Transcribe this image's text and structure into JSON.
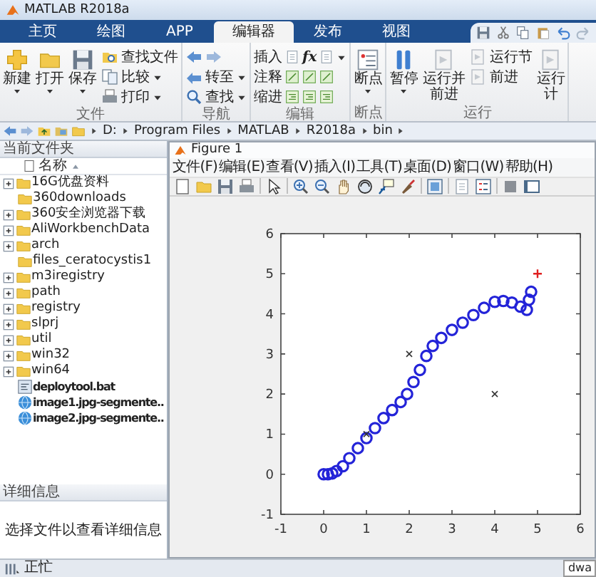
{
  "window": {
    "title": "MATLAB R2018a"
  },
  "tabs": [
    {
      "label": "主页",
      "selected": false
    },
    {
      "label": "绘图",
      "selected": false
    },
    {
      "label": "APP",
      "selected": false
    },
    {
      "label": "编辑器",
      "selected": true
    },
    {
      "label": "发布",
      "selected": false
    },
    {
      "label": "视图",
      "selected": false
    }
  ],
  "ribbon": [
    {
      "label": "文件",
      "buttons": [
        {
          "kind": "large",
          "lines": [
            "新建"
          ],
          "dropdown": true
        },
        {
          "kind": "large",
          "lines": [
            "打开"
          ],
          "dropdown": true
        },
        {
          "kind": "large",
          "lines": [
            "保存"
          ],
          "dropdown": true
        },
        {
          "kind": "stack",
          "items": [
            {
              "label": "查找文件",
              "dropdown": false
            },
            {
              "label": "比较",
              "dropdown": true
            },
            {
              "label": "打印",
              "dropdown": true
            }
          ]
        }
      ]
    },
    {
      "label": "导航",
      "buttons": [
        {
          "kind": "stack",
          "items": [
            {
              "kind": "icons"
            },
            {
              "label": "转至",
              "dropdown": true
            },
            {
              "label": "查找",
              "dropdown": true
            }
          ]
        }
      ]
    },
    {
      "label": "编辑",
      "buttons": [
        {
          "kind": "stack",
          "items": [
            {
              "label": "插入",
              "function_label": "fx",
              "dropdown": true
            },
            {
              "label": "注释",
              "dropdown": false
            },
            {
              "label": "缩进",
              "dropdown": false
            }
          ]
        }
      ]
    },
    {
      "label": "断点",
      "buttons": [
        {
          "kind": "large",
          "lines": [
            "断点"
          ],
          "dropdown": true
        }
      ]
    },
    {
      "label": "运行",
      "buttons": [
        {
          "kind": "large",
          "lines": [
            "暂停"
          ],
          "dropdown": true
        },
        {
          "kind": "large",
          "lines": [
            "运行并",
            "前进"
          ],
          "dropdown": false
        },
        {
          "kind": "stack",
          "items": [
            {
              "label": "运行节",
              "dropdown": false
            },
            {
              "label": "前进",
              "dropdown": false
            }
          ]
        },
        {
          "kind": "large",
          "lines": [
            "运行",
            "计"
          ],
          "dropdown": false
        }
      ]
    }
  ],
  "address": {
    "segments": [
      "D:",
      "Program Files",
      "MATLAB",
      "R2018a",
      "bin"
    ]
  },
  "files": {
    "title": "当前文件夹",
    "column": "名称",
    "items": [
      {
        "kind": "folder",
        "name": "16G优盘资料",
        "expandable": true
      },
      {
        "kind": "folder",
        "name": "360downloads",
        "expandable": false
      },
      {
        "kind": "folder",
        "name": "360安全浏览器下载",
        "expandable": true
      },
      {
        "kind": "folder",
        "name": "AliWorkbenchData",
        "expandable": true
      },
      {
        "kind": "folder",
        "name": "arch",
        "expandable": true
      },
      {
        "kind": "folder",
        "name": "files_ceratocystis1",
        "expandable": false
      },
      {
        "kind": "folder",
        "name": "m3iregistry",
        "expandable": true
      },
      {
        "kind": "folder",
        "name": "path",
        "expandable": true
      },
      {
        "kind": "folder",
        "name": "registry",
        "expandable": true
      },
      {
        "kind": "folder",
        "name": "slprj",
        "expandable": true
      },
      {
        "kind": "folder",
        "name": "util",
        "expandable": true
      },
      {
        "kind": "folder",
        "name": "win32",
        "expandable": true
      },
      {
        "kind": "folder",
        "name": "win64",
        "expandable": true
      },
      {
        "kind": "script",
        "name": "deploytool.bat",
        "expandable": false
      },
      {
        "kind": "web",
        "name": "image1.jpg-segmente..",
        "expandable": false
      },
      {
        "kind": "web",
        "name": "image2.jpg-segmente..",
        "expandable": false
      }
    ]
  },
  "details": {
    "title": "详细信息",
    "message": "选择文件以查看详细信息"
  },
  "figure": {
    "title": "Figure 1",
    "menu": [
      "文件(F)",
      "编辑(E)",
      "查看(V)",
      "插入(I)",
      "工具(T)",
      "桌面(D)",
      "窗口(W)",
      "帮助(H)"
    ],
    "chart_data": {
      "type": "scatter",
      "xlim": [
        -1,
        6
      ],
      "ylim": [
        -1,
        6
      ],
      "xticks": [
        -1,
        0,
        1,
        2,
        3,
        4,
        5,
        6
      ],
      "yticks": [
        -1,
        0,
        1,
        2,
        3,
        4,
        5,
        6
      ],
      "series": [
        {
          "marker": "circle",
          "color": "#2323d8",
          "x": [
            0,
            0.1,
            0.2,
            0.3,
            0.45,
            0.6,
            0.8,
            1,
            1.2,
            1.4,
            1.6,
            1.8,
            1.95,
            2.1,
            2.25,
            2.4,
            2.55,
            2.75,
            3,
            3.25,
            3.5,
            3.75,
            4,
            4.2,
            4.4,
            4.6,
            4.75,
            4.8,
            4.85
          ],
          "values": [
            0,
            0,
            0.02,
            0.08,
            0.2,
            0.4,
            0.65,
            0.9,
            1.15,
            1.4,
            1.6,
            1.8,
            2,
            2.3,
            2.6,
            2.95,
            3.2,
            3.4,
            3.6,
            3.78,
            3.97,
            4.15,
            4.3,
            4.32,
            4.28,
            4.18,
            4.1,
            4.35,
            4.55
          ]
        },
        {
          "marker": "cross",
          "color": "#333333",
          "x": [
            1,
            2,
            4
          ],
          "values": [
            1,
            3,
            2
          ]
        },
        {
          "marker": "plus",
          "color": "#e02020",
          "x": [
            5
          ],
          "values": [
            5
          ]
        }
      ]
    }
  },
  "status": {
    "text": "正忙",
    "field": "dwa"
  }
}
